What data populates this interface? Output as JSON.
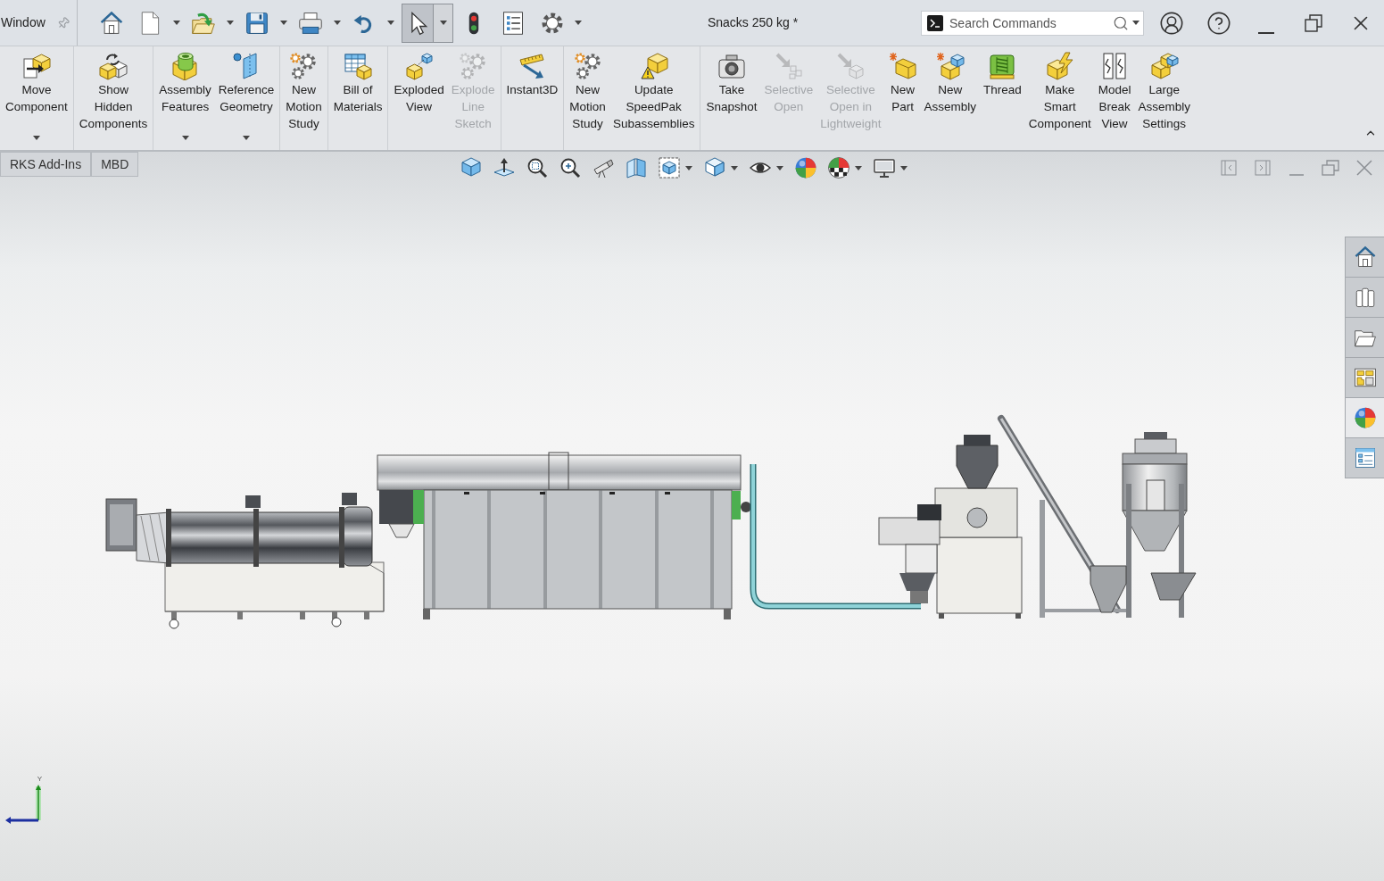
{
  "menu_bar": {
    "items": [
      "Window"
    ]
  },
  "quick_access": {
    "select_tool": {
      "pressed": true
    }
  },
  "title_bar": {
    "document_title": "Snacks 250 kg *",
    "search": {
      "placeholder": "Search Commands"
    }
  },
  "ribbon": {
    "groups": [
      {
        "items": [
          {
            "label": "Move\nComponent",
            "disabled": false,
            "dropdown": true
          }
        ]
      },
      {
        "items": [
          {
            "label": "Show\nHidden\nComponents",
            "disabled": false,
            "dropdown": false
          }
        ]
      },
      {
        "items": [
          {
            "label": "Assembly\nFeatures",
            "disabled": false,
            "dropdown": true
          },
          {
            "label": "Reference\nGeometry",
            "disabled": false,
            "dropdown": true
          }
        ]
      },
      {
        "items": [
          {
            "label": "New\nMotion\nStudy",
            "disabled": false,
            "dropdown": false
          }
        ]
      },
      {
        "items": [
          {
            "label": "Bill of\nMaterials",
            "disabled": false,
            "dropdown": false
          }
        ]
      },
      {
        "items": [
          {
            "label": "Exploded\nView",
            "disabled": false,
            "dropdown": false
          },
          {
            "label": "Explode\nLine\nSketch",
            "disabled": true,
            "dropdown": false
          }
        ]
      },
      {
        "items": [
          {
            "label": "Instant3D",
            "disabled": false,
            "dropdown": false
          }
        ]
      },
      {
        "items": [
          {
            "label": "New\nMotion\nStudy",
            "disabled": false,
            "dropdown": false
          },
          {
            "label": "Update\nSpeedPak\nSubassemblies",
            "disabled": false,
            "dropdown": false
          }
        ]
      },
      {
        "items": [
          {
            "label": "Take\nSnapshot",
            "disabled": false,
            "dropdown": false
          },
          {
            "label": "Selective\nOpen",
            "disabled": true,
            "dropdown": false
          },
          {
            "label": "Selective\nOpen in\nLightweight",
            "disabled": true,
            "dropdown": false
          },
          {
            "label": "New\nPart",
            "disabled": false,
            "dropdown": false
          },
          {
            "label": "New\nAssembly",
            "disabled": false,
            "dropdown": false
          },
          {
            "label": "Thread",
            "disabled": false,
            "dropdown": false
          },
          {
            "label": "Make\nSmart\nComponent",
            "disabled": false,
            "dropdown": false
          },
          {
            "label": "Model\nBreak\nView",
            "disabled": false,
            "dropdown": false
          },
          {
            "label": "Large\nAssembly\nSettings",
            "disabled": false,
            "dropdown": false
          }
        ]
      }
    ]
  },
  "command_tabs": [
    {
      "label": "RKS Add-Ins",
      "selected": false
    },
    {
      "label": "MBD",
      "selected": false
    }
  ],
  "task_pane": [
    {
      "selected": false
    },
    {
      "selected": false
    },
    {
      "selected": false
    },
    {
      "selected": false
    },
    {
      "selected": true
    },
    {
      "selected": false
    }
  ],
  "axis_triad": {
    "label": "Y"
  }
}
